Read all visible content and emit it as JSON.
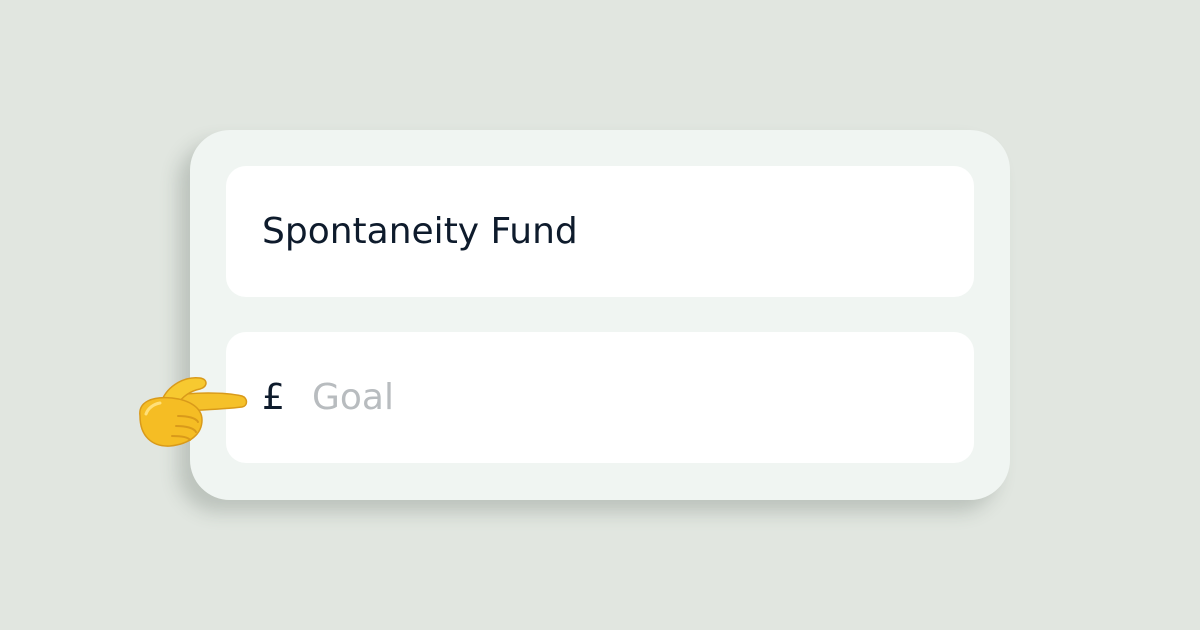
{
  "form": {
    "name_value": "Spontaneity Fund",
    "currency_symbol": "£",
    "goal_placeholder": "Goal"
  },
  "pointer": {
    "icon": "pointing-right-hand-icon"
  },
  "colors": {
    "background": "#e1e6e0",
    "card": "#f0f5f2",
    "field": "#ffffff",
    "text": "#0e1b2c",
    "placeholder": "#b8bcbf",
    "hand": "#f5c12a"
  }
}
